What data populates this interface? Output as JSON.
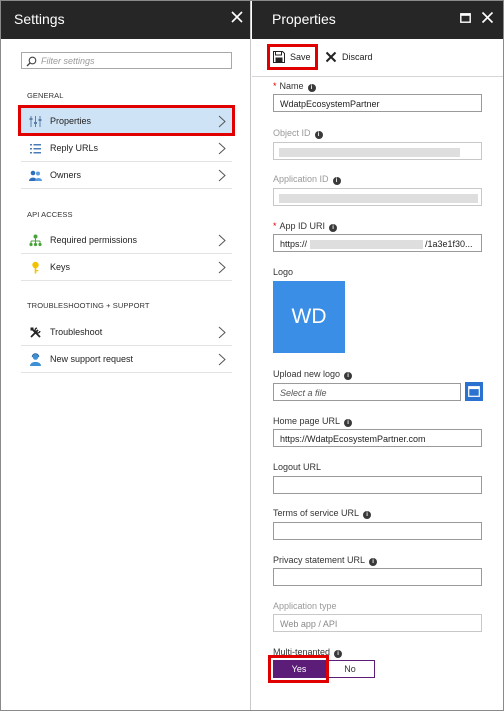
{
  "settings": {
    "title": "Settings",
    "filter_placeholder": "Filter settings",
    "sections": {
      "general": "GENERAL",
      "api_access": "API ACCESS",
      "troubleshooting": "TROUBLESHOOTING + SUPPORT"
    },
    "items": {
      "properties": "Properties",
      "reply_urls": "Reply URLs",
      "owners": "Owners",
      "required_permissions": "Required permissions",
      "keys": "Keys",
      "troubleshoot": "Troubleshoot",
      "new_support_request": "New support request"
    },
    "selected_item": "properties"
  },
  "properties": {
    "title": "Properties",
    "toolbar": {
      "save_label": "Save",
      "discard_label": "Discard"
    },
    "fields": {
      "name": {
        "label": "Name",
        "value": "WdatpEcosystemPartner",
        "required": true
      },
      "object_id": {
        "label": "Object ID",
        "value": ""
      },
      "application_id": {
        "label": "Application ID",
        "value": ""
      },
      "app_id_uri": {
        "label": "App ID URI",
        "value_prefix": "https://",
        "value_suffix": "/1a3e1f30...",
        "required": true
      },
      "logo": {
        "label": "Logo",
        "initials": "WD"
      },
      "upload_logo": {
        "label": "Upload new logo",
        "placeholder": "Select a file"
      },
      "home_page_url": {
        "label": "Home page URL",
        "value": "https://WdatpEcosystemPartner.com"
      },
      "logout_url": {
        "label": "Logout URL",
        "value": ""
      },
      "terms_url": {
        "label": "Terms of service URL",
        "value": ""
      },
      "privacy_url": {
        "label": "Privacy statement URL",
        "value": ""
      },
      "application_type": {
        "label": "Application type",
        "value": "Web app / API"
      },
      "multi_tenanted": {
        "label": "Multi-tenanted",
        "yes_label": "Yes",
        "no_label": "No",
        "selected": "Yes"
      }
    }
  },
  "colors": {
    "header_bg": "#262626",
    "selected_bg": "#cfe3f6",
    "highlight_border": "#e00000",
    "toggle_active": "#5b1d78",
    "logo_bg": "#3a8ee6",
    "browse_button": "#2b72d0"
  },
  "icons": {
    "settings_close": "close-icon",
    "search": "search-icon",
    "properties": "properties-sliders-icon",
    "reply_urls": "list-icon",
    "owners": "users-icon",
    "required_permissions": "hierarchy-icon",
    "keys": "key-icon",
    "troubleshoot": "tools-icon",
    "new_support_request": "support-person-icon",
    "maximize": "maximize-icon",
    "save": "floppy-disk-icon",
    "discard": "x-icon",
    "info": "info-icon",
    "browse": "folder-window-icon"
  }
}
